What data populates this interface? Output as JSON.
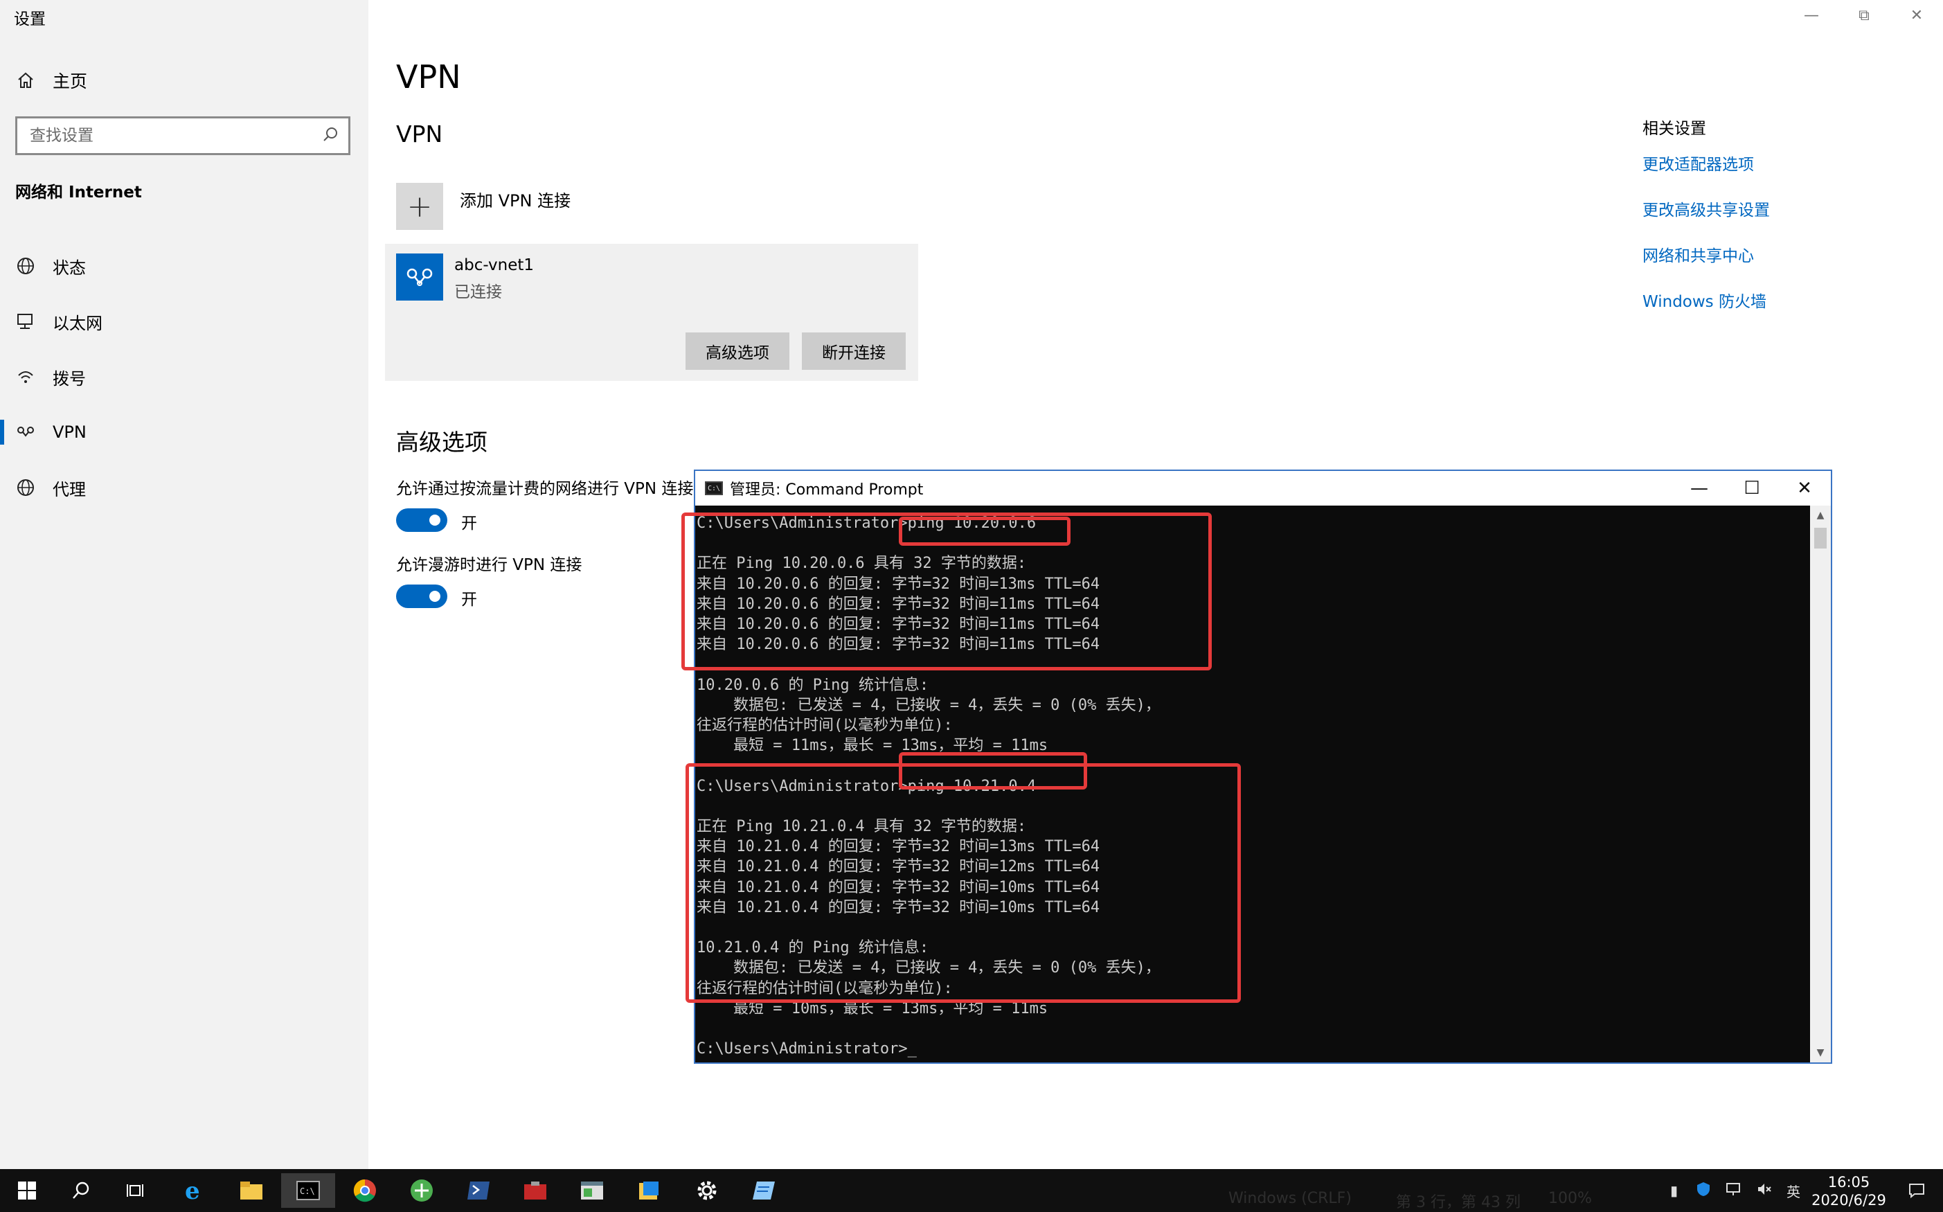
{
  "app_title": "设置",
  "home_label": "主页",
  "search_placeholder": "查找设置",
  "section_title": "网络和 Internet",
  "nav": [
    {
      "label": "状态",
      "icon": "globe-status-icon"
    },
    {
      "label": "以太网",
      "icon": "ethernet-icon"
    },
    {
      "label": "拨号",
      "icon": "dialup-icon"
    },
    {
      "label": "VPN",
      "icon": "vpn-icon",
      "active": true
    },
    {
      "label": "代理",
      "icon": "globe-proxy-icon"
    }
  ],
  "main": {
    "title": "VPN",
    "subtitle": "VPN",
    "add_vpn_label": "添加 VPN 连接",
    "connection": {
      "name": "abc-vnet1",
      "status": "已连接"
    },
    "btn_advanced": "高级选项",
    "btn_disconnect": "断开连接",
    "advanced_title": "高级选项",
    "opt1_label": "允许通过按流量计费的网络进行 VPN 连接",
    "opt1_state": "开",
    "opt2_label": "允许漫游时进行 VPN 连接",
    "opt2_state": "开"
  },
  "related": {
    "title": "相关设置",
    "links": [
      "更改适配器选项",
      "更改高级共享设置",
      "网络和共享中心",
      "Windows 防火墙"
    ]
  },
  "cmd": {
    "title": "管理员: Command Prompt",
    "lines": [
      "C:\\Users\\Administrator>ping 10.20.0.6",
      "",
      "正在 Ping 10.20.0.6 具有 32 字节的数据:",
      "来自 10.20.0.6 的回复: 字节=32 时间=13ms TTL=64",
      "来自 10.20.0.6 的回复: 字节=32 时间=11ms TTL=64",
      "来自 10.20.0.6 的回复: 字节=32 时间=11ms TTL=64",
      "来自 10.20.0.6 的回复: 字节=32 时间=11ms TTL=64",
      "",
      "10.20.0.6 的 Ping 统计信息:",
      "    数据包: 已发送 = 4，已接收 = 4，丢失 = 0 (0% 丢失)，",
      "往返行程的估计时间(以毫秒为单位):",
      "    最短 = 11ms，最长 = 13ms，平均 = 11ms",
      "",
      "C:\\Users\\Administrator>ping 10.21.0.4",
      "",
      "正在 Ping 10.21.0.4 具有 32 字节的数据:",
      "来自 10.21.0.4 的回复: 字节=32 时间=13ms TTL=64",
      "来自 10.21.0.4 的回复: 字节=32 时间=12ms TTL=64",
      "来自 10.21.0.4 的回复: 字节=32 时间=10ms TTL=64",
      "来自 10.21.0.4 的回复: 字节=32 时间=10ms TTL=64",
      "",
      "10.21.0.4 的 Ping 统计信息:",
      "    数据包: 已发送 = 4，已接收 = 4，丢失 = 0 (0% 丢失)，",
      "往返行程的估计时间(以毫秒为单位):",
      "    最短 = 10ms，最长 = 13ms，平均 = 11ms",
      "",
      "C:\\Users\\Administrator>_"
    ]
  },
  "taskbar": {
    "status_left": "Windows (CRLF)",
    "status_mid": "第 3 行，第 43 列",
    "status_zoom": "100%",
    "ime": "英",
    "time": "16:05",
    "date": "2020/6/29"
  },
  "colors": {
    "accent": "#0067c0",
    "highlight": "#e53a3a",
    "console_bg": "#0c0c0c"
  }
}
